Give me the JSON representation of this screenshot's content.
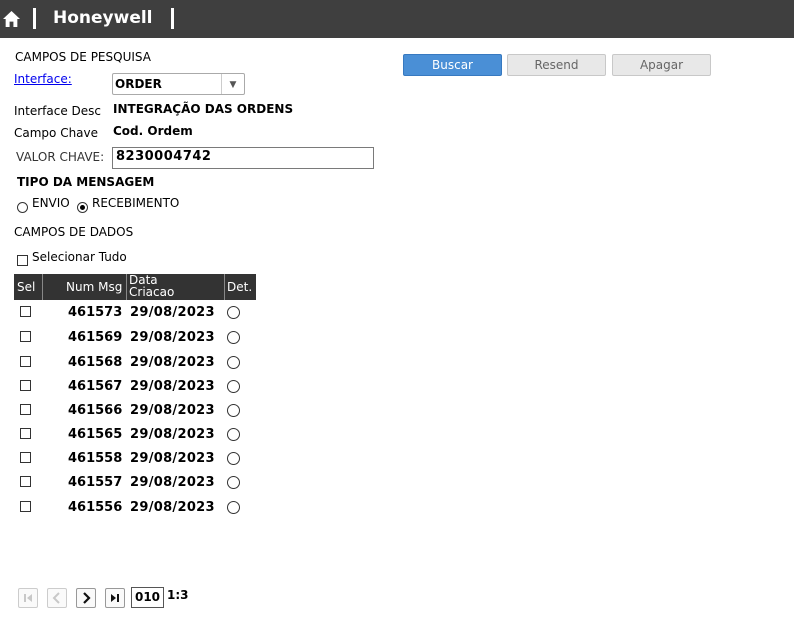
{
  "header": {
    "brand": "Honeywell"
  },
  "search": {
    "section_title": "CAMPOS DE PESQUISA",
    "interface_label": "Interface:",
    "interface_value": "ORDER",
    "interface_desc_label": "Interface Desc",
    "interface_desc_value": "INTEGRAÇÃO DAS ORDENS",
    "campo_chave_label": "Campo Chave",
    "campo_chave_value": "Cod. Ordem",
    "valor_chave_label": "VALOR CHAVE:",
    "valor_chave_value": "8230004742",
    "tipo_label": "TIPO DA MENSAGEM",
    "envio_label": "ENVIO",
    "recebimento_label": "RECEBIMENTO",
    "selected_type": "RECEBIMENTO"
  },
  "buttons": {
    "buscar": "Buscar",
    "resend": "Resend",
    "apagar": "Apagar"
  },
  "data_section": {
    "title": "CAMPOS DE DADOS",
    "select_all_label": "Selecionar Tudo"
  },
  "table": {
    "headers": {
      "sel": "Sel",
      "num": "Num Msg",
      "data_line1": "Data",
      "data_line2": "Criacao",
      "det": "Det."
    },
    "rows": [
      {
        "num": "461573",
        "date": "29/08/2023"
      },
      {
        "num": "461569",
        "date": "29/08/2023"
      },
      {
        "num": "461568",
        "date": "29/08/2023"
      },
      {
        "num": "461567",
        "date": "29/08/2023"
      },
      {
        "num": "461566",
        "date": "29/08/2023"
      },
      {
        "num": "461565",
        "date": "29/08/2023"
      },
      {
        "num": "461558",
        "date": "29/08/2023"
      },
      {
        "num": "461557",
        "date": "29/08/2023"
      },
      {
        "num": "461556",
        "date": "29/08/2023"
      }
    ]
  },
  "pager": {
    "page_size": "010",
    "page_info": "1:3"
  },
  "colors": {
    "header_bg": "#3f3f3f",
    "primary": "#4a8fd6",
    "table_header_bg": "#333333"
  }
}
